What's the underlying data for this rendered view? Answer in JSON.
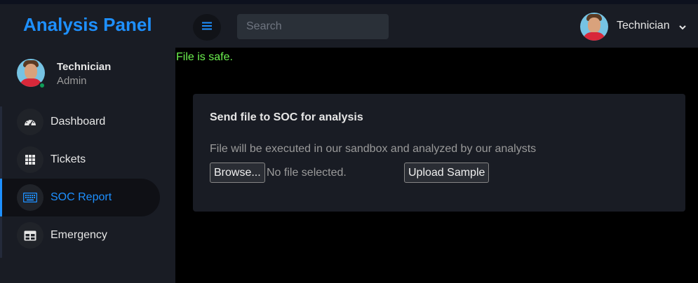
{
  "brand": {
    "title": "Analysis Panel"
  },
  "profile": {
    "name": "Technician",
    "role": "Admin"
  },
  "sidebar": {
    "items": [
      {
        "label": "Dashboard",
        "icon": "speedometer-icon"
      },
      {
        "label": "Tickets",
        "icon": "grid-icon"
      },
      {
        "label": "SOC Report",
        "icon": "keyboard-icon",
        "active": true
      },
      {
        "label": "Emergency",
        "icon": "table-icon"
      }
    ]
  },
  "header": {
    "search_placeholder": "Search",
    "user_name": "Technician"
  },
  "main": {
    "status_message": "File is safe.",
    "card": {
      "title": "Send file to SOC for analysis",
      "description": "File will be executed in our sandbox and analyzed by our analysts",
      "browse_label": "Browse...",
      "file_status": "No file selected.",
      "upload_label": "Upload Sample"
    }
  },
  "colors": {
    "accent": "#1e90ff",
    "success": "#6cf24f",
    "online": "#0f9d58",
    "background": "#191c24",
    "content_background": "#000000"
  }
}
